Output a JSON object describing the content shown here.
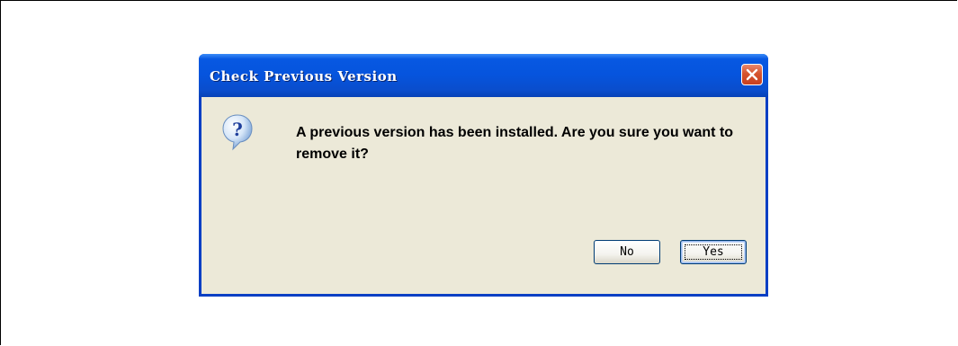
{
  "dialog": {
    "title": "Check Previous Version",
    "message": "A previous version has been installed. Are you sure you want to remove it?",
    "icon": "question-icon",
    "buttons": {
      "no_label": "No",
      "yes_label": "Yes"
    }
  },
  "colors": {
    "titlebar": "#0654dd",
    "client_background": "#ece9d8",
    "close_button": "#d6542e"
  }
}
